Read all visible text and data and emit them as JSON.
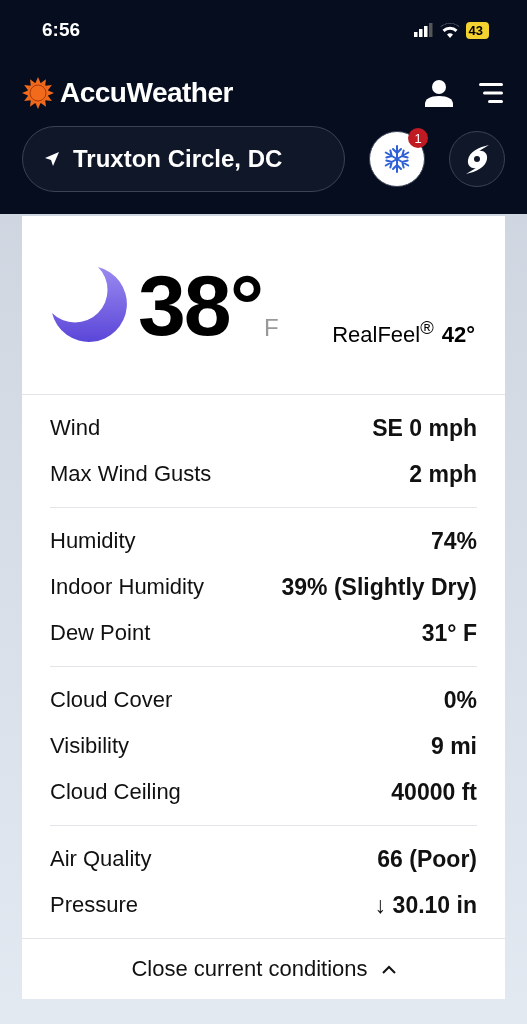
{
  "status_bar": {
    "time": "6:56",
    "battery": "43"
  },
  "header": {
    "brand": "AccuWeather",
    "location": "Truxton Circle, DC",
    "alert_badge": "1"
  },
  "current": {
    "temperature": "38°",
    "unit": "F",
    "realfeel_label": "RealFeel$^{®}$",
    "realfeel_value": "42°"
  },
  "groups": [
    {
      "rows": [
        {
          "label": "Wind",
          "value": "SE 0 mph"
        },
        {
          "label": "Max Wind Gusts",
          "value": "2 mph"
        }
      ]
    },
    {
      "rows": [
        {
          "label": "Humidity",
          "value": "74%"
        },
        {
          "label": "Indoor Humidity",
          "value": "39% (Slightly Dry)"
        },
        {
          "label": "Dew Point",
          "value": "31° F"
        }
      ]
    },
    {
      "rows": [
        {
          "label": "Cloud Cover",
          "value": "0%"
        },
        {
          "label": "Visibility",
          "value": "9 mi"
        },
        {
          "label": "Cloud Ceiling",
          "value": "40000 ft"
        }
      ]
    },
    {
      "rows": [
        {
          "label": "Air Quality",
          "value": "66 (Poor)"
        },
        {
          "label": "Pressure",
          "value": "↓ 30.10 in"
        }
      ]
    }
  ],
  "footer": {
    "toggle": "Close current conditions",
    "expanded": true
  }
}
